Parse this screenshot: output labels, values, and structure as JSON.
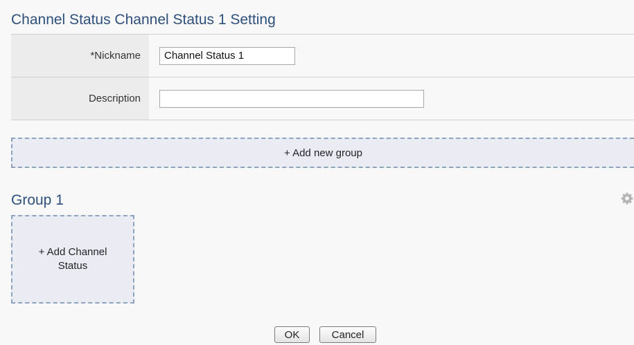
{
  "header": {
    "title": "Channel Status Channel Status 1 Setting"
  },
  "form": {
    "nickname": {
      "label": "*Nickname",
      "value": "Channel Status 1"
    },
    "description": {
      "label": "Description",
      "value": ""
    }
  },
  "groups_section": {
    "add_group_label": "+ Add new group",
    "groups": [
      {
        "title": "Group 1",
        "settings_icon": "gear-icon",
        "add_channel_label": "+ Add Channel Status"
      }
    ]
  },
  "footer": {
    "ok_label": "OK",
    "cancel_label": "Cancel"
  },
  "colors": {
    "title": "#2d4f7c",
    "label_bg": "#ececec",
    "dashed_border": "#8da3bd",
    "dashed_fill": "#e9edf3"
  }
}
